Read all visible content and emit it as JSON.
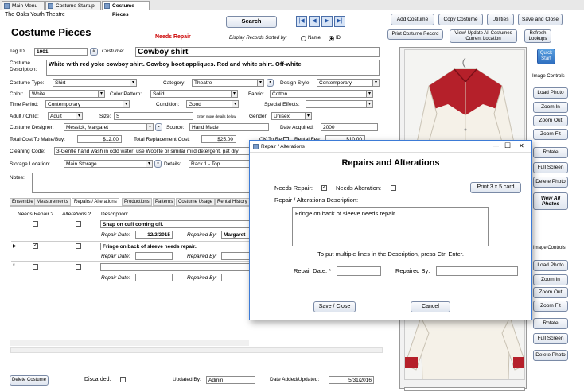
{
  "tabs": [
    "Main Menu",
    "Costume Startup",
    "Costume Pieces"
  ],
  "org_name": "The Oaks Youth Theatre",
  "form_title": "Costume Pieces",
  "needs_repair_flag": "Needs Repair",
  "search_label": "Search",
  "sorted_by_label": "Display Records Sorted by:",
  "sort_options": [
    "Name",
    "ID"
  ],
  "nav_icons": [
    "first-record-icon",
    "prev-record-icon",
    "next-record-icon",
    "last-record-icon"
  ],
  "nav_glyphs": [
    "|◀",
    "◀",
    "▶",
    "▶|"
  ],
  "top_buttons": {
    "add": "Add Costume",
    "copy": "Copy Costume",
    "utilities": "Utilities",
    "save_close": "Save and Close",
    "print_record": "Print Costume Record",
    "view_update": "View/ Update All Costumes Current Location",
    "refresh": "Refresh Lookups",
    "quick_start": "Quick Start"
  },
  "fields": {
    "tag_id_label": "Tag ID:",
    "tag_id": "1001",
    "hash": "#",
    "costume_label": "Costume:",
    "costume": "Cowboy shirt",
    "description_label": "Costume Description:",
    "description": "White with red yoke cowboy shirt.  Cowboy boot appliques.  Red and white shirt. Off-white",
    "type_label": "Costume Type:",
    "type": "Shirt",
    "category_label": "Category:",
    "category": "Theatre",
    "design_style_label": "Design Style:",
    "design_style": "Contemporary",
    "color_label": "Color:",
    "color": "White",
    "color_pattern_label": "Color Pattern:",
    "color_pattern": "Solid",
    "fabric_label": "Fabric:",
    "fabric": "Cotton",
    "time_period_label": "Time Period:",
    "time_period": "Contemporary",
    "condition_label": "Condition:",
    "condition": "Good",
    "special_effects_label": "Special Effects:",
    "special_effects": "",
    "adult_child_label": "Adult / Child:",
    "adult_child": "Adult",
    "size_label": "Size:",
    "size": "S",
    "size_note": "Enter more details below",
    "gender_label": "Gender:",
    "gender": "Unisex",
    "designer_label": "Costume Designer:",
    "designer": "Messick, Margaret",
    "source_label": "Source:",
    "source": "Hand Made",
    "date_acquired_label": "Date Acquired:",
    "date_acquired": "2000",
    "total_cost_label": "Total Cost To Make/Buy:",
    "total_cost": "$12.00",
    "replacement_label": "Total Replacement Cost:",
    "replacement": "$25.00",
    "ok_rent_label": "OK To Rent?",
    "rental_fee_label": "Rental Fee:",
    "rental_fee": "$10.00",
    "cleaning_label": "Cleaning Code:",
    "cleaning": "3-Gentle hand wash in cold water; use Woolite or similar mild detergent, pat dry",
    "storage_label": "Storage Location:",
    "storage": "Main Storage",
    "details_label": "Details:",
    "details": "Rack 1 - Top",
    "notes_label": "Notes:"
  },
  "sub_tabs": [
    "Ensemble",
    "Measurements",
    "Repairs / Alterations",
    "Productions",
    "Patterns",
    "Costume Usage",
    "Rental History"
  ],
  "repairs": {
    "col_needs_repair": "Needs Repair ?",
    "col_alterations": "Alterations ?",
    "col_description": "Description:",
    "repair_date_label": "Repair Date:",
    "repaired_by_label": "Repaired By:",
    "rows": [
      {
        "description": "Snap on cuff coming off.",
        "repair_date": "12/2/2015",
        "repaired_by": "Margaret",
        "needs_repair": false,
        "alteration": false
      },
      {
        "description": "Fringe on back of sleeve needs repair.",
        "repair_date": "",
        "repaired_by": "",
        "needs_repair": true,
        "alteration": false
      },
      {
        "description": "",
        "repair_date": "",
        "repaired_by": "",
        "needs_repair": false,
        "alteration": false
      }
    ]
  },
  "footer": {
    "delete": "Delete Costume",
    "discarded_label": "Discarded:",
    "updated_by_label": "Updated By:",
    "updated_by": "Admin",
    "date_added_label": "Date Added/Updated:",
    "date_added": "5/31/2016"
  },
  "image_controls": {
    "title": "Image Controls",
    "buttons": [
      "Load Photo",
      "Zoom In",
      "Zoom Out",
      "Zoom Fit",
      "Rotate",
      "Full Screen",
      "Delete Photo"
    ],
    "view_all": "View All Photos"
  },
  "dialog": {
    "window_title": "Repair / Alterations",
    "controls": [
      "—",
      "☐",
      "✕"
    ],
    "heading": "Repairs and Alterations",
    "needs_repair_label": "Needs Repair:",
    "needs_repair": true,
    "needs_alteration_label": "Needs Alteration:",
    "needs_alteration": false,
    "print_label": "Print 3 x 5 card",
    "desc_label": "Repair / Alterations Description:",
    "description": "Fringe on back of sleeve needs repair.",
    "hint": "To put multiple lines in the Description, press Ctrl Enter.",
    "repair_date_label": "Repair Date: *",
    "repaired_by_label": "Repaired By:",
    "save_label": "Save / Close",
    "cancel_label": "Cancel"
  },
  "colors": {
    "accent": "#2456a6",
    "needs_repair": "#cc0000",
    "window_border": "#3d7bd6",
    "shirt_red": "#b5202a"
  }
}
